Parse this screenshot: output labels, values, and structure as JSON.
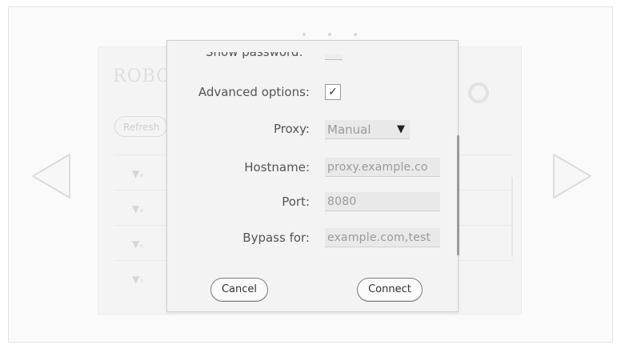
{
  "pager": {
    "dots": 3
  },
  "background": {
    "title": "ROBO",
    "refresh_label": "Refresh",
    "network_rows": [
      "▼ₓ",
      "▼ₓ",
      "▼ₓ",
      "▼ₓ"
    ]
  },
  "dialog": {
    "show_password_label": "Show password:",
    "advanced_label": "Advanced options:",
    "advanced_checked_glyph": "✓",
    "proxy_label": "Proxy:",
    "proxy_value": "Manual",
    "proxy_arrow": "▼",
    "hostname_label": "Hostname:",
    "hostname_value": "proxy.example.co",
    "port_label": "Port:",
    "port_value": "8080",
    "bypass_label": "Bypass for:",
    "bypass_value": "example.com,test",
    "cancel_label": "Cancel",
    "connect_label": "Connect"
  },
  "icons": {
    "left_arrow": "chevron-left-icon",
    "right_arrow": "chevron-right-icon",
    "wifi": "wifi-icon",
    "gear": "gear-icon",
    "dropdown": "triangle-down-icon"
  },
  "colors": {
    "frame": "#fafafa",
    "dialog": "#f3f3f3",
    "field": "#e9e9e9",
    "border": "#cfcfcf"
  }
}
